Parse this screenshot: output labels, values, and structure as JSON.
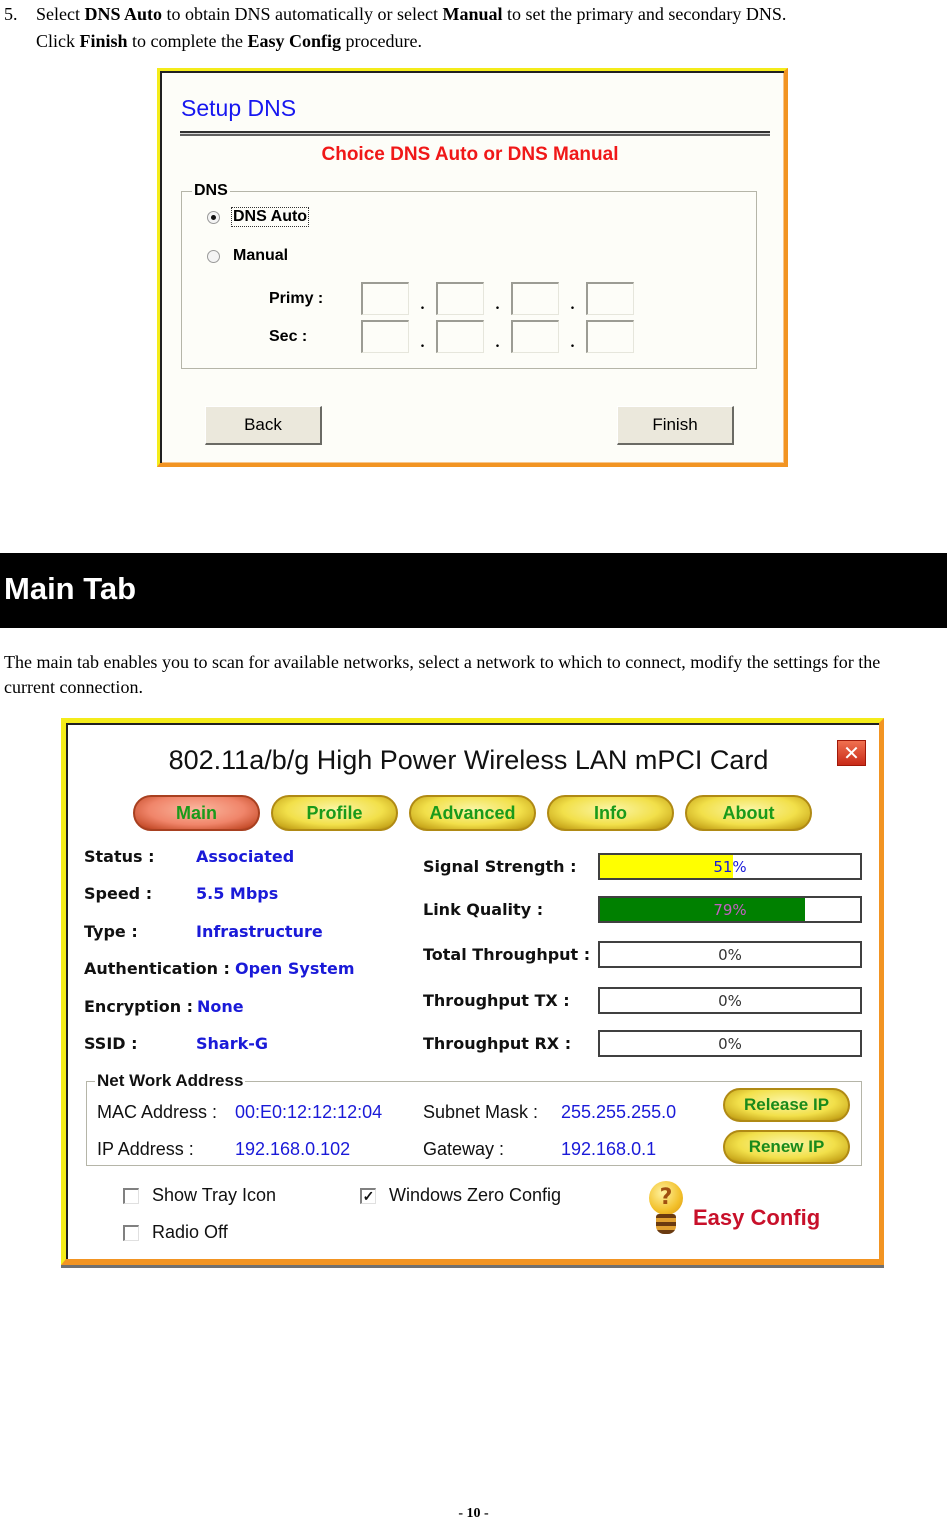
{
  "step": {
    "number": "5.",
    "line1": [
      {
        "text": "Select ",
        "bold": false
      },
      {
        "text": "DNS Auto",
        "bold": true
      },
      {
        "text": " to obtain DNS automatically or select ",
        "bold": false
      },
      {
        "text": "Manual",
        "bold": true
      },
      {
        "text": " to set the primary and secondary DNS.",
        "bold": false
      }
    ],
    "line2": [
      {
        "text": "Click ",
        "bold": false
      },
      {
        "text": "Finish",
        "bold": true
      },
      {
        "text": " to complete the ",
        "bold": false
      },
      {
        "text": "Easy Config",
        "bold": true
      },
      {
        "text": " procedure.",
        "bold": false
      }
    ]
  },
  "dns_dialog": {
    "title": "Setup DNS",
    "subtitle": "Choice DNS Auto or DNS Manual",
    "group_label": "DNS",
    "options": [
      {
        "label": "DNS Auto",
        "selected": true
      },
      {
        "label": "Manual",
        "selected": false
      }
    ],
    "primary_label": "Primy :",
    "secondary_label": "Sec :",
    "primary_octets": [
      "",
      "",
      "",
      ""
    ],
    "secondary_octets": [
      "",
      "",
      "",
      ""
    ],
    "back_label": "Back",
    "finish_label": "Finish"
  },
  "section": {
    "title": "Main Tab",
    "intro": "The main tab enables you to scan for available networks, select a network to which to connect, modify the settings for the current connection."
  },
  "utility": {
    "title": "802.11a/b/g High Power Wireless LAN mPCI Card",
    "close_glyph": "✕",
    "tabs": [
      {
        "label": "Main",
        "active": true
      },
      {
        "label": "Profile",
        "active": false
      },
      {
        "label": "Advanced",
        "active": false
      },
      {
        "label": "Info",
        "active": false
      },
      {
        "label": "About",
        "active": false
      }
    ],
    "info": [
      {
        "label": "Status :",
        "value": "Associated"
      },
      {
        "label": "Speed :",
        "value": "5.5 Mbps"
      },
      {
        "label": "Type :",
        "value": "Infrastructure"
      },
      {
        "label": "Authentication :",
        "value": "Open System"
      },
      {
        "label": "Encryption :",
        "value": "None"
      },
      {
        "label": "SSID :",
        "value": "Shark-G"
      }
    ],
    "meters": [
      {
        "label": "Signal Strength :",
        "percent": 51,
        "text": "51%",
        "fill_color": "#ffff00",
        "text_color": "#1a1ad8"
      },
      {
        "label": "Link Quality :",
        "percent": 79,
        "text": "79%",
        "fill_color": "#008000",
        "text_color": "#c060c0"
      },
      {
        "label": "Total Throughput :",
        "percent": 0,
        "text": "0%",
        "fill_color": "#008000",
        "text_color": "#333333"
      },
      {
        "label": "Throughput TX :",
        "percent": 0,
        "text": "0%",
        "fill_color": "#008000",
        "text_color": "#333333"
      },
      {
        "label": "Throughput RX :",
        "percent": 0,
        "text": "0%",
        "fill_color": "#008000",
        "text_color": "#333333"
      }
    ],
    "network": {
      "group_label": "Net Work Address",
      "mac_label": "MAC Address :",
      "mac_value": "00:E0:12:12:12:04",
      "ip_label": "IP Address :",
      "ip_value": "192.168.0.102",
      "subnet_label": "Subnet Mask :",
      "subnet_value": "255.255.255.0",
      "gateway_label": "Gateway :",
      "gateway_value": "192.168.0.1",
      "release_label": "Release IP",
      "renew_label": "Renew IP"
    },
    "checkboxes": [
      {
        "label": "Show Tray Icon",
        "checked": false
      },
      {
        "label": "Windows Zero Config",
        "checked": true
      },
      {
        "label": "Radio Off",
        "checked": false
      }
    ],
    "easy_config_label": "Easy Config",
    "bulb_glyph": "?"
  },
  "footer": {
    "page_number": "- 10 -"
  }
}
